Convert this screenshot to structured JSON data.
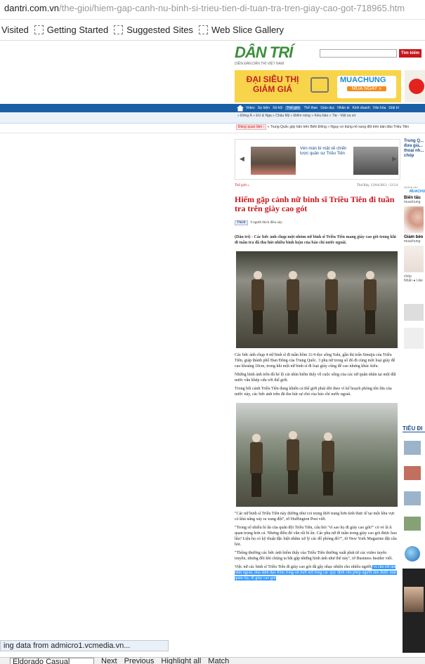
{
  "browser": {
    "url_host": "dantri.com.vn",
    "url_path": "/the-gioi/hiem-gap-canh-nu-binh-si-trieu-tien-di-tuan-tra-tren-giay-cao-got-718965.htm",
    "bookmarks": [
      "Visited",
      "Getting Started",
      "Suggested Sites",
      "Web Slice Gallery"
    ],
    "status": "ing data from admicro1.vcmedia.vn...",
    "find": {
      "value": "Eldorado Casual",
      "next": "Next",
      "previous": "Previous",
      "highlight": "Highlight all",
      "match": "Match"
    }
  },
  "site": {
    "logo": "DÂN TRÍ",
    "logo_sub": "DIỄN ĐÀN DÂN TRÍ VIỆT NAM",
    "search_button": "Tìm kiếm",
    "banner": {
      "left": "ĐẠI SIÊU THỊ GIẢM GIÁ",
      "brand": "MUACHUNG",
      "cta": "MUA NGAY »"
    },
    "nav": [
      "Video",
      "Sự kiện",
      "Xã hội",
      "Thế giới",
      "Thể thao",
      "Giáo dục",
      "Nhân ái",
      "Kinh doanh",
      "Văn hóa",
      "Giải trí"
    ],
    "nav_active": "Thế giới",
    "subnav": "» Đông Á  » EU & Nga  » Châu Mỹ  » Điểm nóng  » Kiều bào  » Tài - Việt xa xứ",
    "hot_tag": "Đáng quan tâm ›",
    "hot_1": "» Trung Quốc gây hấn trên Biển Đông",
    "hot_2": "» Nguy cơ bùng nổ xung đột trên bán đảo Triều Tiên"
  },
  "related": {
    "caption": "Vén màn bí mật về chiến lược quân sự Triều Tiên",
    "right_caption": "Trung Q... đưa giả... thoại nh... chóp"
  },
  "sidebar": {
    "ads_label": "Quảng cáo",
    "ads_brand": "MUACHUNG",
    "ad1_title": "Biến tấu",
    "ad1_sub": "muachung",
    "ad2_title": "Giảm béo",
    "ad2_sub": "muachung",
    "ad2_more": "chóp",
    "ad3": "Nhấn ● Like",
    "news_heading": "TIÊU ĐI",
    "list": [
      "",
      "",
      "",
      ""
    ]
  },
  "article": {
    "category": "Thế giới »",
    "date": "Thứ Bảy, 13/04/2013 - 12:54",
    "title": "Hiếm gặp cảnh nữ binh sĩ Triều Tiên đi tuần tra trên giày cao gót",
    "share": "Thích",
    "share_count": "9 người thích điều này.",
    "lead": "(Dân trí) - Các bức ảnh chụp một nhóm nữ binh sĩ Triều Tiên mang giày cao gót trong khi đi tuần tra đã thu hút nhiều bình luận của báo chí nước ngoài.",
    "p1": "Các bức ảnh chụp 4 nữ binh sĩ đi tuần hôm 11/4 dọc sông Yalu, gần thị trấn Sinuiju của Triều Tiên, giáp thành phố Đan Đông của Trung Quốc. 3 phụ nữ trong số đó đi cùng một loại giày để cao khoảng 10cm, trong khi một nữ binh sĩ đi loại giày cũng để cao nhưng khác kiểu.",
    "p2": "Những hình ảnh trên đã hé lộ cái nhìn hiếm thấy về cuộc sống của các nữ quân nhân tại một đất nước vẫn khép cửa với thế giới.",
    "p3": "Trong bối cảnh Triều Tiên đang khiến cả thế giới phải dõi theo vì kế hoạch phóng tên lửa của nước này, các bức ảnh trên đã thu hút sự chú của báo chí nước ngoài.",
    "p4": "\"Các nữ binh sĩ Triều Tiên này dường như coi trọng thời trang hơn tình thực tế tại một khu vực có khả năng xảy ra xung đột\", tờ Huffington Post viết.",
    "p5": "\"Trong số nhiều bí ẩn của quân đội Triều Tiên, câu hỏi \"vì sao họ đi giày cao gót?\" có vẻ là ít quan trọng hơn cả. Nhưng điều đó vẫn rất bí ẩn. Các phụ nữ đi tuần trong giày cao gót được bao lâu? Liệu họ có kỹ thuật đặc biệt nhằm xử lý các đổ phòng đó?\", tờ New York Magazine đặt câu hỏi.",
    "p6": "\"Thông thường các bức ảnh hiếm thấy của Triều Tiên thường xuất phát từ các video tuyên truyền, nhưng đôi khi chúng ta bắt gặp những hình ảnh như thế này\", tờ Business Insider viết.",
    "p7_start": "Việc nữ các binh sĩ Triều Tiên đi giày cao gót đã gây nhạc nhiên cho nhiều người,",
    "p7_hl": " vì cho tới tận năm ngoái, nhà lãnh đạo Kim Jong-un mới nới lỏng các quy định cho phép người dân được mặc quần tây, đi giày cao gót"
  }
}
